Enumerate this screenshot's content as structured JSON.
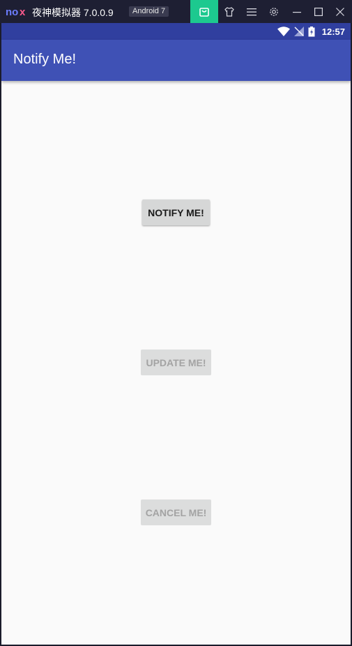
{
  "emulator": {
    "title": "夜神模拟器 7.0.0.9",
    "android_badge": "Android 7",
    "accent_color": "#1dc98f",
    "logo_text": "nox"
  },
  "status_bar": {
    "time": "12:57",
    "color": "#303f9f"
  },
  "app_bar": {
    "title": "Notify Me!",
    "color": "#3f51b5"
  },
  "buttons": {
    "notify": {
      "label": "NOTIFY ME!",
      "enabled": true
    },
    "update": {
      "label": "UPDATE ME!",
      "enabled": false
    },
    "cancel": {
      "label": "CANCEL ME!",
      "enabled": false
    }
  }
}
